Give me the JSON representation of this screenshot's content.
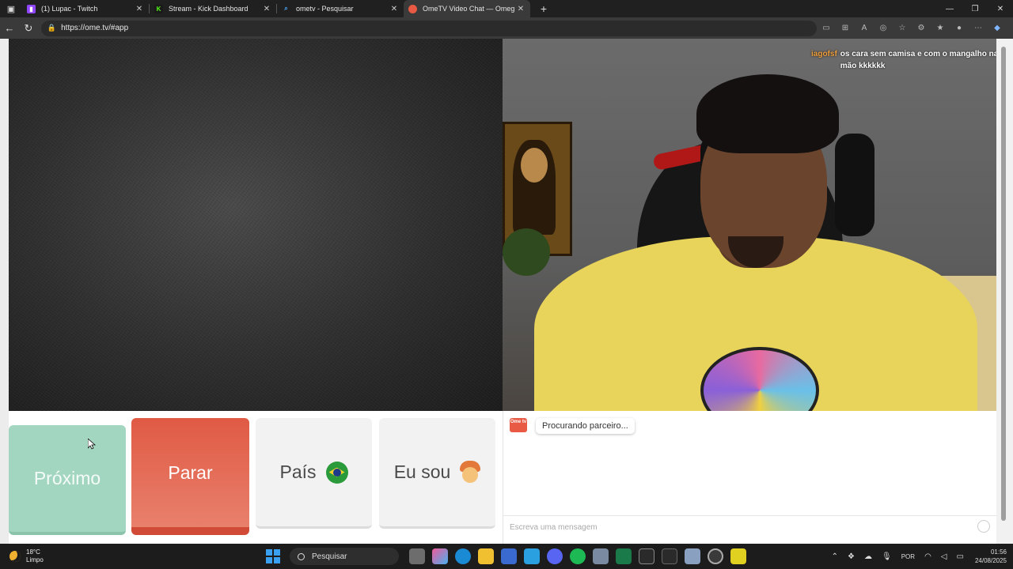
{
  "browser": {
    "tabs": [
      {
        "title": "(1) Lupac - Twitch",
        "icon": "twitch-icon",
        "color": "#9146ff",
        "active": false
      },
      {
        "title": "Stream - Kick Dashboard",
        "icon": "kick-icon",
        "color": "#53fc18",
        "active": false
      },
      {
        "title": "ometv - Pesquisar",
        "icon": "search-icon",
        "color": "#4aa8ff",
        "active": false
      },
      {
        "title": "OmeTV Video Chat — Omeg",
        "icon": "ometv-icon",
        "color": "#e85a44",
        "active": true
      }
    ],
    "url": "https://ome.tv/#app"
  },
  "remote_video": {
    "chat_overlay": {
      "user": "iagofsf",
      "message": "os cara sem camisa e com o mangalho na mão kkkkkk"
    }
  },
  "controls": {
    "next_label": "Próximo",
    "stop_label": "Parar",
    "country_label": "País",
    "iam_label": "Eu sou"
  },
  "chat": {
    "logo_text": "Ome tv",
    "status_text": "Procurando parceiro...",
    "input_placeholder": "Escreva uma mensagem"
  },
  "taskbar": {
    "weather_temp": "18°C",
    "weather_desc": "Limpo",
    "search_placeholder": "Pesquisar",
    "language": "POR",
    "time": "01:56",
    "date": "24/08/2025"
  },
  "colors": {
    "next_button": "#a3d6c0",
    "stop_button": "#e05a44",
    "accent_windows": "#3aa0f0"
  }
}
